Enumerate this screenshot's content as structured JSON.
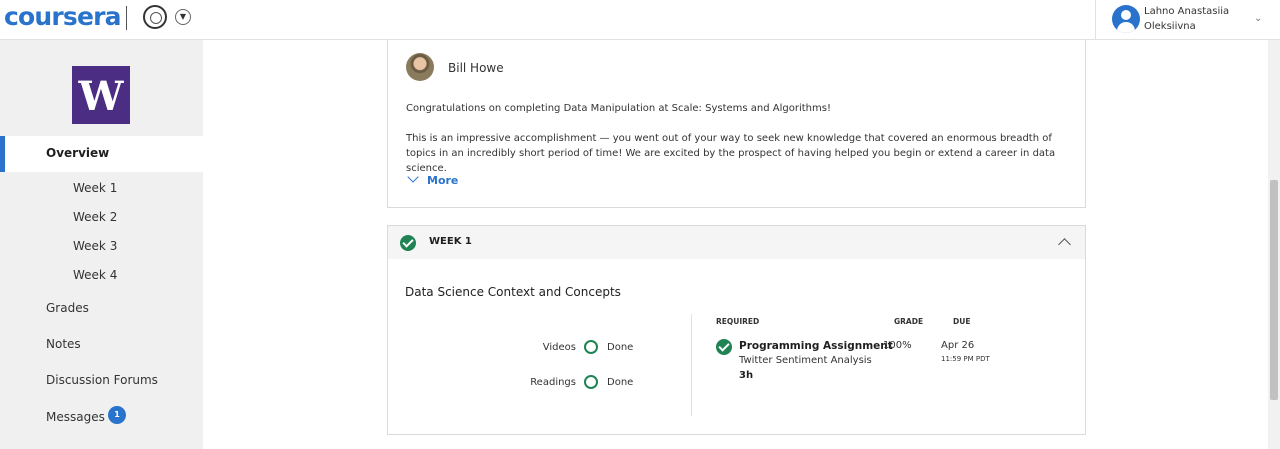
{
  "header": {
    "logo_text": "coursera",
    "user_name": "Lahno Anastasiia Oleksiivna"
  },
  "sidebar": {
    "school_logo_letter": "W",
    "overview": "Overview",
    "weeks": [
      "Week 1",
      "Week 2",
      "Week 3",
      "Week 4"
    ],
    "items": [
      "Grades",
      "Notes",
      "Discussion Forums",
      "Messages"
    ],
    "messages_badge": "1",
    "active_color": "#2a73cc"
  },
  "instructor": {
    "name": "Bill Howe",
    "message_p1": "Congratulations on completing Data Manipulation at Scale: Systems and Algorithms!",
    "message_p2": "This is an impressive accomplishment — you went out of your way to seek new knowledge that covered an enormous breadth of topics in an incredibly short period of time! We are excited by the prospect of having helped you begin or extend a career in data science.",
    "more_label": "More"
  },
  "week": {
    "title": "WEEK 1",
    "topic": "Data Science Context and Concepts",
    "stats": [
      {
        "label": "Videos",
        "status": "Done"
      },
      {
        "label": "Readings",
        "status": "Done"
      }
    ],
    "columns": {
      "required": "REQUIRED",
      "grade": "GRADE",
      "due": "DUE"
    },
    "assignment": {
      "type": "Programming Assignment",
      "name": "Twitter Sentiment Analysis",
      "duration": "3h",
      "grade": "100%",
      "due_date": "Apr 26",
      "due_time": "11:59 PM PDT"
    },
    "complete_color": "#1f8354"
  }
}
